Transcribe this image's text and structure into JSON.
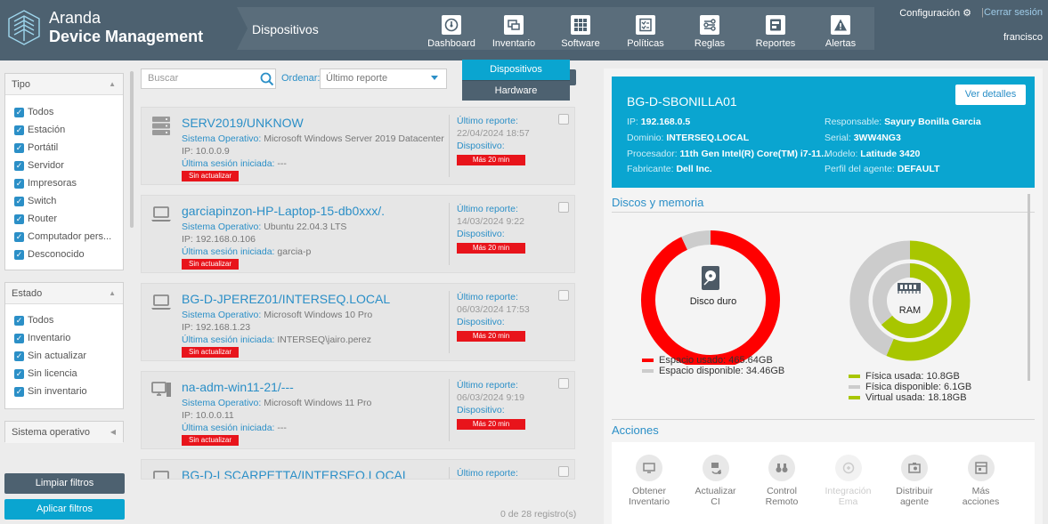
{
  "header": {
    "brand_line1": "Aranda",
    "brand_line2": "Device Management",
    "section_title": "Dispositivos",
    "nav": [
      {
        "label": "Dashboard",
        "icon": "dashboard-icon"
      },
      {
        "label": "Inventario",
        "icon": "inventory-icon"
      },
      {
        "label": "Software",
        "icon": "software-grid-icon"
      },
      {
        "label": "Políticas",
        "icon": "policies-icon"
      },
      {
        "label": "Reglas",
        "icon": "rules-icon"
      },
      {
        "label": "Reportes",
        "icon": "reports-icon"
      },
      {
        "label": "Alertas",
        "icon": "alert-icon"
      }
    ],
    "config_label": "Configuración",
    "logout_label": "Cerrar sesión",
    "separator": "|",
    "username": "francisco"
  },
  "submenu": {
    "items": [
      "Dispositivos",
      "Hardware"
    ],
    "colors": {
      "active": "#0aa5d0",
      "normal": "#4d6170"
    }
  },
  "filters": {
    "tipo": {
      "title": "Tipo",
      "items": [
        "Todos",
        "Estación",
        "Portátil",
        "Servidor",
        "Impresoras",
        "Switch",
        "Router",
        "Computador pers...",
        "Desconocido"
      ]
    },
    "estado": {
      "title": "Estado",
      "items": [
        "Todos",
        "Inventario",
        "Sin actualizar",
        "Sin licencia",
        "Sin inventario"
      ]
    },
    "so": {
      "title": "Sistema operativo"
    },
    "clear_label": "Limpiar filtros",
    "apply_label": "Aplicar filtros",
    "check_mark": "✓",
    "colors": {
      "clear": "#4d6170",
      "apply": "#0aa5d0"
    }
  },
  "toolbar": {
    "search_placeholder": "Buscar",
    "order_label": "Ordenar:",
    "order_value": "Último reporte"
  },
  "devices": [
    {
      "name": "SERV2019/UNKNOW",
      "icon": "server-icon",
      "so_label": "Sistema Operativo:",
      "so": "Microsoft Windows Server 2019 Datacenter",
      "ip": "IP: 10.0.0.9",
      "session_label": "Última sesión iniciada:",
      "session": "---",
      "badge": "Sin actualizar",
      "report_label": "Último reporte:",
      "report_date": "22/04/2024 18:57",
      "device_label": "Dispositivo:",
      "device_badge": "Más 20 min"
    },
    {
      "name": "garciapinzon-HP-Laptop-15-db0xxx/.",
      "icon": "laptop-icon",
      "so_label": "Sistema Operativo:",
      "so": "Ubuntu 22.04.3 LTS",
      "ip": "IP: 192.168.0.106",
      "session_label": "Última sesión iniciada:",
      "session": "garcia-p",
      "badge": "Sin actualizar",
      "report_label": "Último reporte:",
      "report_date": "14/03/2024 9:22",
      "device_label": "Dispositivo:",
      "device_badge": "Más 20 min"
    },
    {
      "name": "BG-D-JPEREZ01/INTERSEQ.LOCAL",
      "icon": "laptop-icon",
      "so_label": "Sistema Operativo:",
      "so": "Microsoft Windows 10 Pro",
      "ip": "IP: 192.168.1.23",
      "session_label": "Última sesión iniciada:",
      "session": "INTERSEQ\\jairo.perez",
      "badge": "Sin actualizar",
      "report_label": "Último reporte:",
      "report_date": "06/03/2024 17:53",
      "device_label": "Dispositivo:",
      "device_badge": "Más 20 min"
    },
    {
      "name": "na-adm-win11-21/---",
      "icon": "desktop-icon",
      "so_label": "Sistema Operativo:",
      "so": "Microsoft Windows 11 Pro",
      "ip": "IP: 10.0.0.11",
      "session_label": "Última sesión iniciada:",
      "session": "---",
      "badge": "Sin actualizar",
      "report_label": "Último reporte:",
      "report_date": "06/03/2024 9:19",
      "device_label": "Dispositivo:",
      "device_badge": "Más 20 min"
    },
    {
      "name": "BG-D-LSCARPETTA/INTERSEQ.LOCAL",
      "icon": "laptop-icon",
      "report_label": "Último reporte:"
    }
  ],
  "list_count": "0 de 28 registro(s)",
  "detail": {
    "title": "BG-D-SBONILLA01",
    "details_button": "Ver detalles",
    "left": [
      {
        "k": "IP:",
        "v": "192.168.0.5"
      },
      {
        "k": "Dominio:",
        "v": "INTERSEQ.LOCAL"
      },
      {
        "k": "Procesador:",
        "v": "11th Gen Intel(R) Core(TM) i7-11..."
      },
      {
        "k": "Fabricante:",
        "v": "Dell Inc."
      }
    ],
    "right": [
      {
        "k": "Responsable:",
        "v": "Sayury Bonilla Garcia"
      },
      {
        "k": "Serial:",
        "v": "3WW4NG3"
      },
      {
        "k": "Modelo:",
        "v": "Latitude 3420"
      },
      {
        "k": "Perfil del agente:",
        "v": "DEFAULT"
      }
    ]
  },
  "disk_section_title": "Discos y memoria",
  "chart_data": [
    {
      "type": "pie",
      "title": "Disco duro",
      "series": [
        {
          "name": "Espacio usado",
          "value_gb": 465.64,
          "color": "#ff0000"
        },
        {
          "name": "Espacio disponible",
          "value_gb": 34.46,
          "color": "#cccccc"
        }
      ],
      "legend": [
        "Espacio usado: 465.64GB",
        "Espacio disponible: 34.46GB"
      ]
    },
    {
      "type": "pie",
      "title": "RAM",
      "series": [
        {
          "name": "Física usada",
          "value_gb": 10.8,
          "color": "#a8c600"
        },
        {
          "name": "Física disponible",
          "value_gb": 6.1,
          "color": "#cccccc"
        },
        {
          "name": "Virtual usada",
          "value_gb": 18.18,
          "color": "#a8c600"
        }
      ],
      "legend": [
        "Física usada: 10.8GB",
        "Física disponible: 6.1GB",
        "Virtual usada: 18.18GB"
      ]
    }
  ],
  "actions": {
    "title": "Acciones",
    "items": [
      {
        "label1": "Obtener",
        "label2": "Inventario",
        "icon": "inventory-monitor-icon",
        "enabled": true
      },
      {
        "label1": "Actualizar",
        "label2": "CI",
        "icon": "update-ci-icon",
        "enabled": true
      },
      {
        "label1": "Control",
        "label2": "Remoto",
        "icon": "binoculars-icon",
        "enabled": true
      },
      {
        "label1": "Integración",
        "label2": "Ema",
        "icon": "integration-icon",
        "enabled": false
      },
      {
        "label1": "Distribuir",
        "label2": "agente",
        "icon": "distribute-agent-icon",
        "enabled": true
      },
      {
        "label1": "Más",
        "label2": "acciones",
        "icon": "more-actions-icon",
        "enabled": true
      }
    ]
  }
}
